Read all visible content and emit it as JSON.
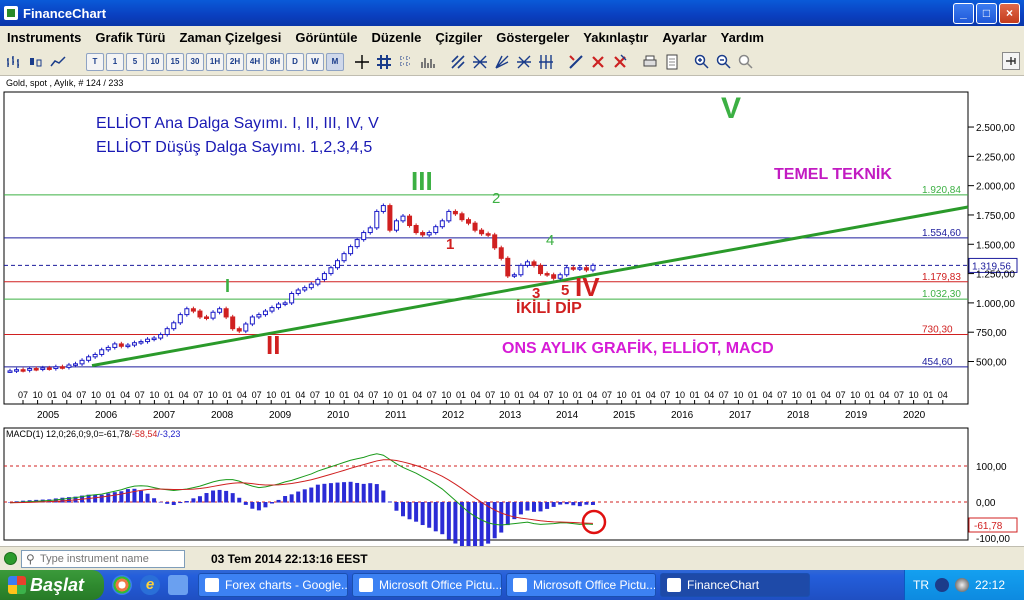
{
  "window": {
    "title": "FinanceChart",
    "controls": {
      "minimize": "_",
      "maximize": "□",
      "close": "×"
    }
  },
  "menu": [
    "Instruments",
    "Grafik Türü",
    "Zaman Çizelgesi",
    "Görüntüle",
    "Düzenle",
    "Çizgiler",
    "Göstergeler",
    "Yakınlaştır",
    "Ayarlar",
    "Yardım"
  ],
  "toolbar": {
    "timeframes": [
      "T",
      "1",
      "5",
      "10",
      "15",
      "30",
      "1H",
      "2H",
      "4H",
      "8H",
      "D",
      "W",
      "M"
    ],
    "selected": "M"
  },
  "chart": {
    "info": "Gold, spot , Aylık, # 124 / 233",
    "annotations": {
      "elliot_main": "ELLİOT Ana Dalga Sayımı.    I, II, III, IV, V",
      "elliot_down": "ELLİOT Düşüş Dalga Sayımı.  1,2,3,4,5",
      "temel": "TEMEL TEKNİK",
      "ons": "ONS AYLIK GRAFİK,  ELLİOT,  MACD",
      "ikili": "İKİLİ DİP",
      "wave_I": "I",
      "wave_II": "II",
      "wave_III": "III",
      "wave_IV": "IV",
      "wave_V": "V",
      "d1": "1",
      "d2": "2",
      "d3": "3",
      "d4": "4",
      "d5": "5"
    },
    "price_axis": [
      "2.500,00",
      "2.250,00",
      "2.000,00",
      "1.750,00",
      "1.500,00",
      "1.250,00",
      "1.000,00",
      "750,00",
      "500,00"
    ],
    "levels": [
      {
        "label": "1.920,84",
        "value": 1920.84,
        "color": "#3cb043"
      },
      {
        "label": "1.554,60",
        "value": 1554.6,
        "color": "#1c1c9c"
      },
      {
        "label": "1.319,56",
        "value": 1319.56,
        "color": "#1c1c9c"
      },
      {
        "label": "1.179,83",
        "value": 1179.83,
        "color": "#d02020"
      },
      {
        "label": "1.032,30",
        "value": 1032.3,
        "color": "#3cb043"
      },
      {
        "label": "730,30",
        "value": 730.3,
        "color": "#d02020"
      },
      {
        "label": "454,60",
        "value": 454.6,
        "color": "#1c1c9c"
      }
    ],
    "years": [
      "2005",
      "2006",
      "2007",
      "2008",
      "2009",
      "2010",
      "2011",
      "2012",
      "2013",
      "2014",
      "2015",
      "2016",
      "2017",
      "2018",
      "2019",
      "2020"
    ],
    "month_ticks": "07 10 01 04",
    "colors": {
      "bull": "#1c1cc8",
      "bear": "#d02020",
      "trend": "#2a9a2a",
      "magenta": "#c21bc2",
      "blue_text": "#1a1ab4"
    }
  },
  "macd": {
    "label_black": "MACD(1) 12,0;26,0;9,0=-61,78/",
    "label_red": "-58,54",
    "label_blue": "/-3,23",
    "axis": [
      "100,00",
      "0,00",
      "-100,00"
    ],
    "current": "-61,78"
  },
  "status": {
    "input_placeholder": "Type instrument name",
    "datetime": "03 Tem 2014 22:13:16 EEST"
  },
  "taskbar": {
    "start": "Başlat",
    "tasks": [
      "Forex charts - Google...",
      "Microsoft Office Pictu...",
      "Microsoft Office Pictu...",
      "FinanceChart"
    ],
    "lang": "TR",
    "time": "22:12"
  }
}
